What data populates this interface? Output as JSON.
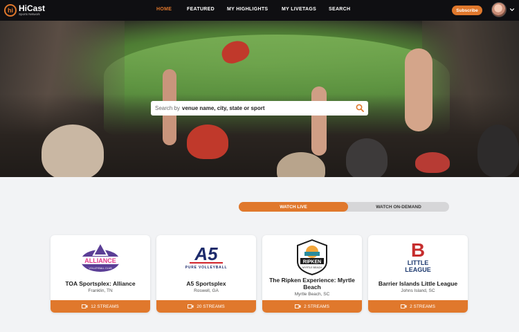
{
  "header": {
    "logo_brand": "HiCast",
    "logo_sub": "Sports Network",
    "logo_mark": "hi",
    "nav": [
      {
        "label": "HOME",
        "active": true
      },
      {
        "label": "FEATURED",
        "active": false
      },
      {
        "label": "MY HIGHLIGHTS",
        "active": false
      },
      {
        "label": "MY LIVETAGS",
        "active": false
      },
      {
        "label": "SEARCH",
        "active": false
      }
    ],
    "subscribe_label": "Subscribe",
    "avatar_icon": "user-avatar",
    "menu_icon": "chevron-down-icon"
  },
  "search": {
    "prefix": "Search by",
    "emphasis": "venue name, city, state or sport",
    "icon": "search-icon"
  },
  "toggle": {
    "live_label": "WATCH LIVE",
    "ondemand_label": "WATCH ON-DEMAND",
    "selected": "WATCH LIVE"
  },
  "venues": [
    {
      "name": "TOA Sportsplex: Alliance",
      "location": "Franklin, TN",
      "streams": "12 STREAMS",
      "logo_text": [
        "ALLIANCE",
        "VOLLEYBALL CLUB"
      ]
    },
    {
      "name": "A5 Sportsplex",
      "location": "Roswell, GA",
      "streams": "20 STREAMS",
      "logo_text": [
        "A5",
        "PURE VOLLEYBALL"
      ]
    },
    {
      "name": "The Ripken Experience: Myrtle Beach",
      "location": "Myrtle Beach, SC",
      "streams": "2 STREAMS",
      "logo_text": [
        "RIPKEN",
        "MYRTLE BEACH"
      ]
    },
    {
      "name": "Barrier Islands Little League",
      "location": "Johns Island, SC",
      "streams": "2 STREAMS",
      "logo_text": [
        "B",
        "LITTLE",
        "LEAGUE"
      ]
    }
  ],
  "colors": {
    "accent": "#e0782c",
    "header_bg": "#0f0f12",
    "page_bg": "#f2f3f5"
  }
}
